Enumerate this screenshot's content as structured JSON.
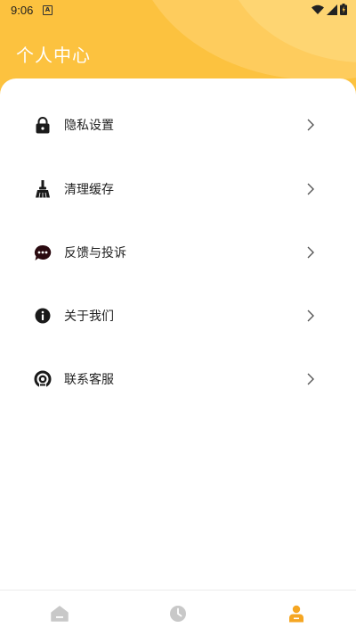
{
  "status_bar": {
    "time": "9:06",
    "notification_letter": "A"
  },
  "header": {
    "title": "个人中心",
    "accent_color": "#fcc23f"
  },
  "menu": {
    "items": [
      {
        "label": "隐私设置",
        "icon": "lock-icon"
      },
      {
        "label": "清理缓存",
        "icon": "broom-icon"
      },
      {
        "label": "反馈与投诉",
        "icon": "chat-bubble-icon"
      },
      {
        "label": "关于我们",
        "icon": "info-icon"
      },
      {
        "label": "联系客服",
        "icon": "headset-icon"
      }
    ]
  },
  "tabbar": {
    "tabs": [
      {
        "icon": "home-icon",
        "active": false
      },
      {
        "icon": "clock-icon",
        "active": false
      },
      {
        "icon": "profile-icon",
        "active": true
      }
    ],
    "active_color": "#f5a623",
    "inactive_color": "#c8c8c8"
  }
}
